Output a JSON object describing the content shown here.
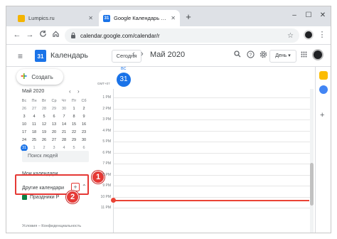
{
  "browser": {
    "tabs": [
      {
        "title": "Lumpics.ru",
        "favicon_color": "#f4b400",
        "active": false
      },
      {
        "title": "Google Календарь - воскресен",
        "favicon_color": "#1a73e8",
        "favicon_text": "31",
        "active": true
      }
    ],
    "new_tab": "+",
    "window_controls": {
      "minimize": "–",
      "maximize": "☐",
      "close": "✕"
    },
    "url": "calendar.google.com/calendar/r",
    "nav": {
      "back": "←",
      "forward": "→",
      "reload": "C"
    }
  },
  "header": {
    "menu_icon": "≡",
    "logo_text": "31",
    "app_title": "Календарь",
    "today_button": "Сегодня",
    "prev": "‹",
    "next": "›",
    "month_title": "Май 2020",
    "view_select": "День ▾"
  },
  "sidebar": {
    "create_button": "Создать",
    "mini_calendar": {
      "title": "Май 2020",
      "weekdays": [
        "Вс",
        "Пн",
        "Вт",
        "Ср",
        "Чт",
        "Пт",
        "Сб"
      ],
      "days": [
        [
          "26",
          "27",
          "28",
          "29",
          "30",
          "1",
          "2"
        ],
        [
          "3",
          "4",
          "5",
          "6",
          "7",
          "8",
          "9"
        ],
        [
          "10",
          "11",
          "12",
          "13",
          "14",
          "15",
          "16"
        ],
        [
          "17",
          "18",
          "19",
          "20",
          "21",
          "22",
          "23"
        ],
        [
          "24",
          "25",
          "26",
          "27",
          "28",
          "29",
          "30"
        ],
        [
          "31",
          "1",
          "2",
          "3",
          "4",
          "5",
          "6"
        ]
      ],
      "selected_day": "31"
    },
    "search_people_placeholder": "Поиск людей",
    "my_calendars": "Мои календари",
    "other_calendars": "Другие календари",
    "other_plus": "+",
    "holiday_calendar": "Праздники Р",
    "footer": "Условия – Конфиденциальность"
  },
  "annotations": {
    "badge1": "1",
    "badge2": "2"
  },
  "day_view": {
    "gmt_label": "GMT+07",
    "day_name": "ВС",
    "day_number": "31",
    "hours": [
      "1 PM",
      "2 PM",
      "3 PM",
      "4 PM",
      "5 PM",
      "6 PM",
      "7 PM",
      "8 PM",
      "9 PM",
      "10 PM",
      "11 PM"
    ]
  }
}
